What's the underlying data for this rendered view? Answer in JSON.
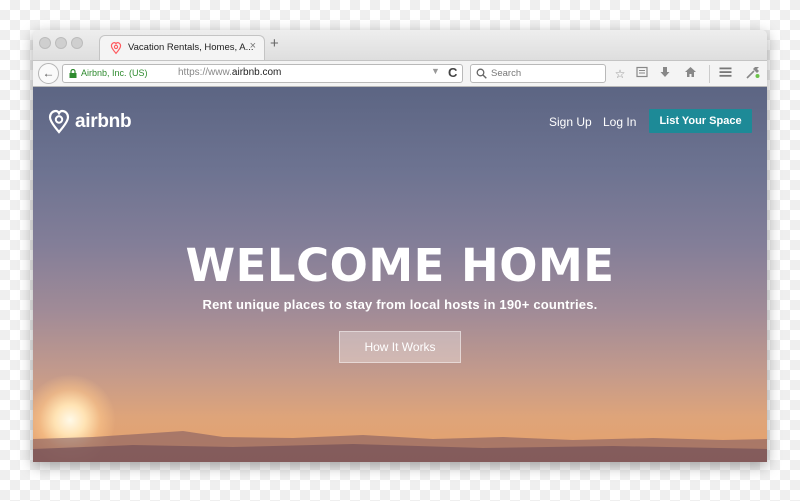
{
  "browser": {
    "tab_title": "Vacation Rentals, Homes, A...",
    "tab_close": "×",
    "new_tab": "+",
    "back": "←",
    "identity_label": "Airbnb, Inc. (US)",
    "url_prefix": "https://www.",
    "url_domain": "airbnb.com",
    "dropmarker": "▼",
    "reload": "C",
    "search_placeholder": "Search",
    "toolbar_icons": [
      "star-icon",
      "reading-list-icon",
      "download-icon",
      "home-icon",
      "menu-icon",
      "developer-icon"
    ]
  },
  "site": {
    "brand": "airbnb",
    "nav": {
      "sign_up": "Sign Up",
      "log_in": "Log In",
      "list_space": "List Your Space"
    },
    "hero": {
      "title": "WELCOME HOME",
      "subtitle": "Rent unique places to stay from local hosts in 190+ countries.",
      "cta": "How It Works"
    }
  },
  "colors": {
    "accent": "#1d8a97",
    "secure_green": "#2e8b2e",
    "airbnb_logo_red": "#ff5a5f"
  }
}
